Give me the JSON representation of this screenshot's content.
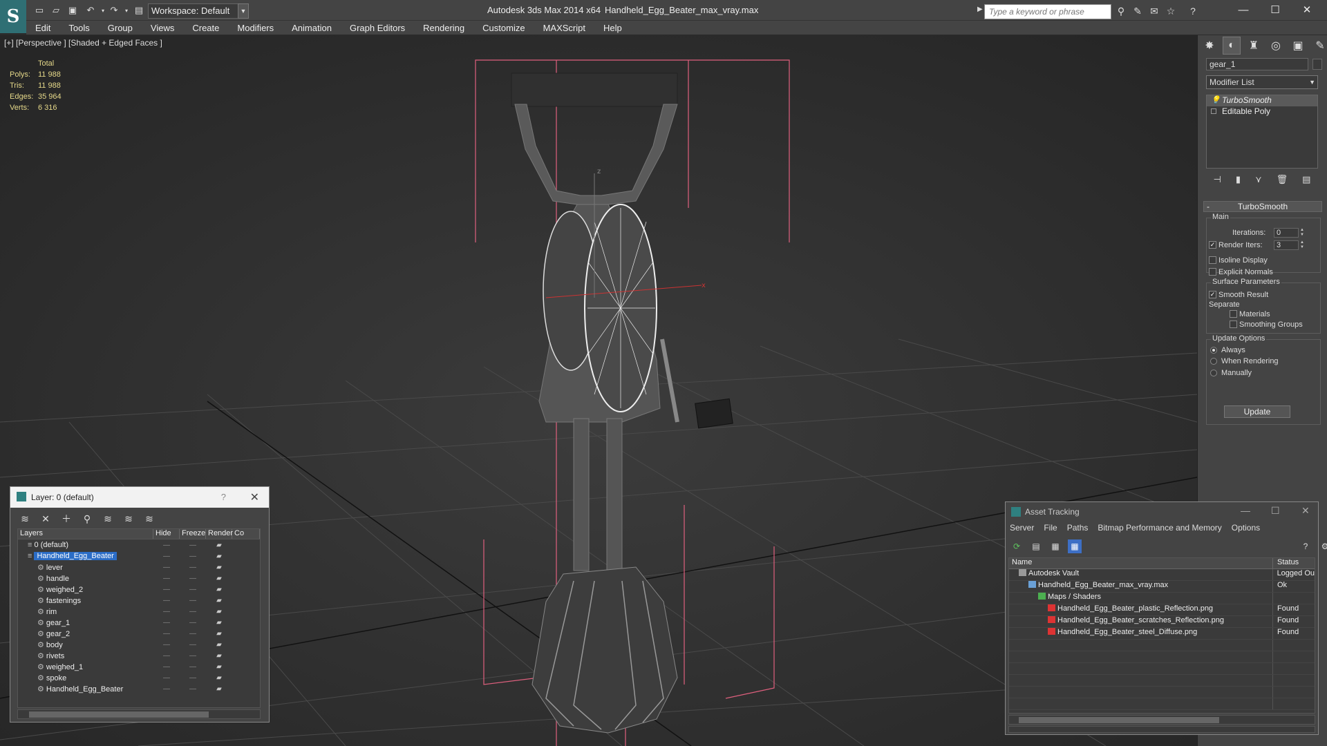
{
  "titlebar": {
    "workspace": "Workspace: Default",
    "app_title": "Autodesk 3ds Max  2014 x64",
    "doc_title": "Handheld_Egg_Beater_max_vray.max",
    "search_placeholder": "Type a keyword or phrase"
  },
  "menu": [
    "Edit",
    "Tools",
    "Group",
    "Views",
    "Create",
    "Modifiers",
    "Animation",
    "Graph Editors",
    "Rendering",
    "Customize",
    "MAXScript",
    "Help"
  ],
  "viewport": {
    "label": "[+] [Perspective ] [Shaded + Edged Faces ]",
    "stats": {
      "header": "Total",
      "rows": [
        {
          "label": "Polys:",
          "value": "11 988"
        },
        {
          "label": "Tris:",
          "value": "11 988"
        },
        {
          "label": "Edges:",
          "value": "35 964"
        },
        {
          "label": "Verts:",
          "value": "6 316"
        }
      ]
    }
  },
  "command_panel": {
    "object_name": "gear_1",
    "modifier_list": "Modifier List",
    "stack": [
      "TurboSmooth",
      "Editable Poly"
    ],
    "rollout_title": "TurboSmooth",
    "main_group": "Main",
    "iterations_label": "Iterations:",
    "iterations_value": "0",
    "render_iters_label": "Render Iters:",
    "render_iters_value": "3",
    "isoline_label": "Isoline Display",
    "explicit_normals_label": "Explicit Normals",
    "surface_group": "Surface Parameters",
    "smooth_result_label": "Smooth Result",
    "separate_label": "Separate",
    "materials_label": "Materials",
    "smoothing_groups_label": "Smoothing Groups",
    "update_group": "Update Options",
    "always_label": "Always",
    "when_rendering_label": "When Rendering",
    "manually_label": "Manually",
    "update_button": "Update"
  },
  "layer_dialog": {
    "title": "Layer: 0 (default)",
    "help": "?",
    "columns": [
      "Layers",
      "Hide",
      "Freeze",
      "Render",
      "Co"
    ],
    "rows": [
      {
        "name": "0 (default)",
        "level": 0,
        "selected": false
      },
      {
        "name": "Handheld_Egg_Beater",
        "level": 0,
        "selected": true
      },
      {
        "name": "lever",
        "level": 1,
        "selected": false
      },
      {
        "name": "handle",
        "level": 1,
        "selected": false
      },
      {
        "name": "weighed_2",
        "level": 1,
        "selected": false
      },
      {
        "name": "fastenings",
        "level": 1,
        "selected": false
      },
      {
        "name": "rim",
        "level": 1,
        "selected": false
      },
      {
        "name": "gear_1",
        "level": 1,
        "selected": false
      },
      {
        "name": "gear_2",
        "level": 1,
        "selected": false
      },
      {
        "name": "body",
        "level": 1,
        "selected": false
      },
      {
        "name": "rivets",
        "level": 1,
        "selected": false
      },
      {
        "name": "weighed_1",
        "level": 1,
        "selected": false
      },
      {
        "name": "spoke",
        "level": 1,
        "selected": false
      },
      {
        "name": "Handheld_Egg_Beater",
        "level": 1,
        "selected": false
      }
    ]
  },
  "asset_dialog": {
    "title": "Asset Tracking",
    "menu": [
      "Server",
      "File",
      "Paths",
      "Bitmap Performance and Memory",
      "Options"
    ],
    "columns": [
      "Name",
      "Status"
    ],
    "rows": [
      {
        "name": "Autodesk Vault",
        "status": "Logged Ou",
        "indent": 1,
        "icon": "vault-icon"
      },
      {
        "name": "Handheld_Egg_Beater_max_vray.max",
        "status": "Ok",
        "indent": 2,
        "icon": "max-file-icon"
      },
      {
        "name": "Maps / Shaders",
        "status": "",
        "indent": 3,
        "icon": "maps-folder-icon"
      },
      {
        "name": "Handheld_Egg_Beater_plastic_Reflection.png",
        "status": "Found",
        "indent": 4,
        "icon": "png-icon"
      },
      {
        "name": "Handheld_Egg_Beater_scratches_Reflection.png",
        "status": "Found",
        "indent": 4,
        "icon": "png-icon"
      },
      {
        "name": "Handheld_Egg_Beater_steel_Diffuse.png",
        "status": "Found",
        "indent": 4,
        "icon": "png-icon"
      }
    ]
  }
}
